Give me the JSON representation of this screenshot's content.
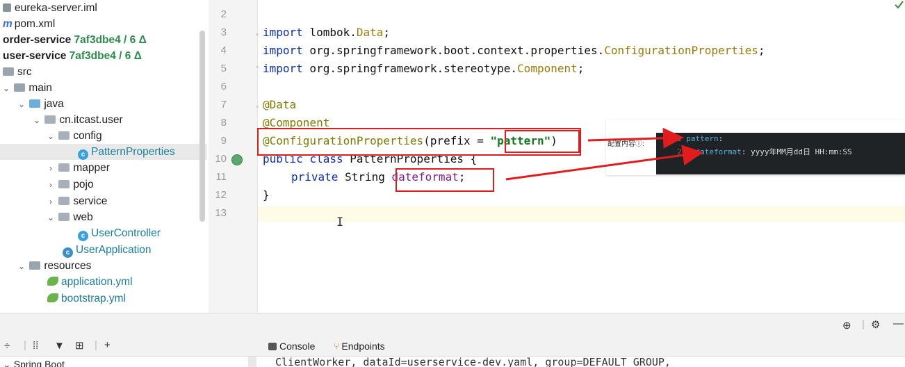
{
  "tree": {
    "rows": [
      {
        "label": "eureka-server.iml"
      },
      {
        "label": "pom.xml"
      },
      {
        "label": "order-service",
        "hash": "7af3dbe4 / 6 Δ"
      },
      {
        "label": "user-service",
        "hash": "7af3dbe4 / 6 Δ"
      },
      {
        "label": "src"
      },
      {
        "label": "main"
      },
      {
        "label": "java"
      },
      {
        "label": "cn.itcast.user"
      },
      {
        "label": "config"
      },
      {
        "label": "PatternProperties"
      },
      {
        "label": "mapper"
      },
      {
        "label": "pojo"
      },
      {
        "label": "service"
      },
      {
        "label": "web"
      },
      {
        "label": "UserController"
      },
      {
        "label": "UserApplication"
      },
      {
        "label": "resources"
      },
      {
        "label": "application.yml"
      },
      {
        "label": "bootstrap.yml"
      }
    ]
  },
  "gutter": {
    "lines": [
      "2",
      "3",
      "4",
      "5",
      "6",
      "7",
      "8",
      "9",
      "10",
      "11",
      "12",
      "13"
    ]
  },
  "code": {
    "line3_kw": "import",
    "line3_pkg": " lombok.",
    "line3_cls": "Data",
    "line3_end": ";",
    "line4_kw": "import",
    "line4_pkg": " org.springframework.boot.context.properties.",
    "line4_cls": "ConfigurationProperties",
    "line4_end": ";",
    "line5_kw": "import",
    "line5_pkg": " org.springframework.stereotype.",
    "line5_cls": "Component",
    "line5_end": ";",
    "line7": "@Data",
    "line8": "@Component",
    "line9_ann": "@ConfigurationProperties",
    "line9_mid": "(prefix = ",
    "line9_str": "\"pattern\"",
    "line9_end": ")",
    "line10_kw": "public class",
    "line10_rest": " PatternProperties {",
    "line11_kw": "private",
    "line11_type": " String ",
    "line11_field": "dateformat",
    "line11_end": ";",
    "line12": "}"
  },
  "popup": {
    "label": "配置内容ⓘ:",
    "line1_num": "1",
    "line1_key": "pattern",
    "line1_colon": ":",
    "line2_num": "2",
    "line2_key": "dateformat",
    "line2_colon": ": ",
    "line2_val": "yyyy年MM月dd日 HH:mm:SS"
  },
  "bottom": {
    "tab_console": "Console",
    "tab_endpoints": "Endpoints",
    "tree_label": "Spring Boot",
    "console_text": "ClientWorker, dataId=userservice-dev.yaml, group=DEFAULT_GROUP,"
  },
  "colors": {
    "annotation_box": "#e01c1c",
    "arrow": "#e01c1c"
  }
}
